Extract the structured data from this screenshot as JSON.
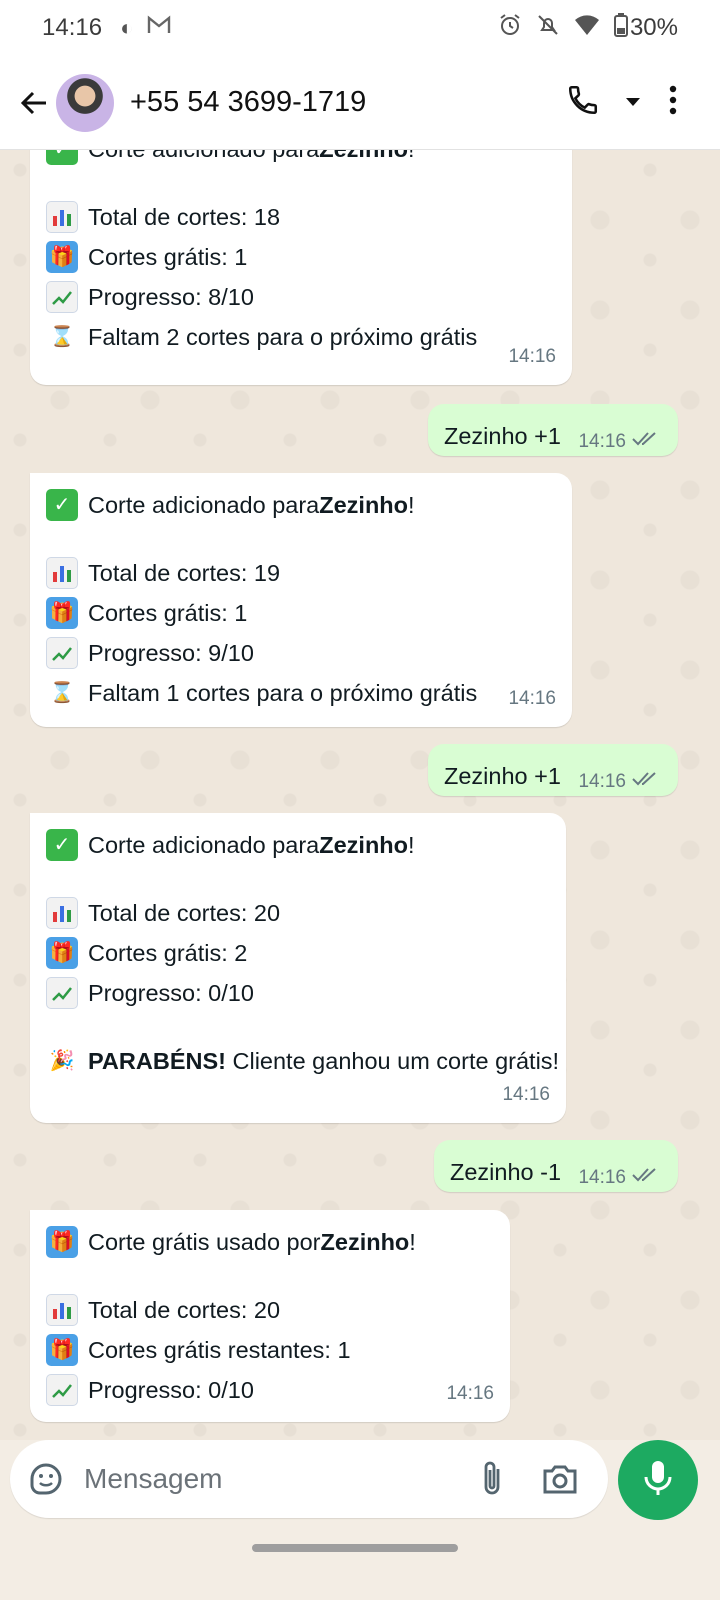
{
  "status_bar": {
    "time": "14:16",
    "battery": "30%"
  },
  "header": {
    "contact": "+55 54 3699-1719"
  },
  "messages": [
    {
      "dir": "in",
      "lines": [
        {
          "kind": "text",
          "pre": "Corte adicionado para ",
          "bold": "Zezinho",
          "post": "!"
        },
        {
          "kind": "gap"
        },
        {
          "kind": "text",
          "pre": "Total de cortes: 18"
        },
        {
          "kind": "text",
          "pre": "Cortes grátis: 1"
        },
        {
          "kind": "text",
          "pre": "Progresso: 8/10"
        },
        {
          "kind": "text",
          "pre": "Faltam 2 cortes para o próximo grátis"
        }
      ],
      "time": "14:16"
    },
    {
      "dir": "out",
      "text": "Zezinho +1",
      "time": "14:16"
    },
    {
      "dir": "in",
      "lines": [
        {
          "kind": "text",
          "pre": "Corte adicionado para ",
          "bold": "Zezinho",
          "post": "!"
        },
        {
          "kind": "gap"
        },
        {
          "kind": "text",
          "pre": "Total de cortes: 19"
        },
        {
          "kind": "text",
          "pre": "Cortes grátis: 1"
        },
        {
          "kind": "text",
          "pre": "Progresso: 9/10"
        },
        {
          "kind": "text",
          "pre": "Faltam 1 cortes para o próximo grátis"
        }
      ],
      "time": "14:16"
    },
    {
      "dir": "out",
      "text": "Zezinho +1",
      "time": "14:16"
    },
    {
      "dir": "in",
      "lines": [
        {
          "kind": "text",
          "pre": "Corte adicionado para ",
          "bold": "Zezinho",
          "post": "!"
        },
        {
          "kind": "gap"
        },
        {
          "kind": "text",
          "pre": "Total de cortes: 20"
        },
        {
          "kind": "text",
          "pre": "Cortes grátis: 2"
        },
        {
          "kind": "text",
          "pre": "Progresso: 0/10"
        },
        {
          "kind": "gap"
        },
        {
          "kind": "text",
          "bold_first": "PARABÉNS!",
          "pre": " Cliente ganhou um corte grátis!"
        }
      ],
      "time": "14:16"
    },
    {
      "dir": "out",
      "text": "Zezinho -1",
      "time": "14:16"
    },
    {
      "dir": "in",
      "lines": [
        {
          "kind": "text",
          "pre": "Corte grátis usado por ",
          "bold": "Zezinho",
          "post": "!"
        },
        {
          "kind": "gap"
        },
        {
          "kind": "text",
          "pre": "Total de cortes: 20"
        },
        {
          "kind": "text",
          "pre": "Cortes grátis restantes: 1"
        },
        {
          "kind": "text",
          "pre": "Progresso: 0/10"
        }
      ],
      "time": "14:16"
    }
  ],
  "composer": {
    "placeholder": "Mensagem"
  },
  "icons": {
    "status": [
      "night-mode-icon",
      "gmail-icon",
      "alarm-icon",
      "mute-icon",
      "wifi-icon",
      "battery-icon"
    ],
    "emoji": [
      "check-emoji-icon",
      "chart-emoji-icon",
      "gift-emoji-icon",
      "trend-emoji-icon",
      "hourglass-emoji-icon",
      "party-emoji-icon"
    ]
  },
  "colors": {
    "outgoing": "#d9fdd3",
    "incoming": "#ffffff",
    "accent": "#1daa61",
    "chat_bg": "#efe7dc"
  }
}
